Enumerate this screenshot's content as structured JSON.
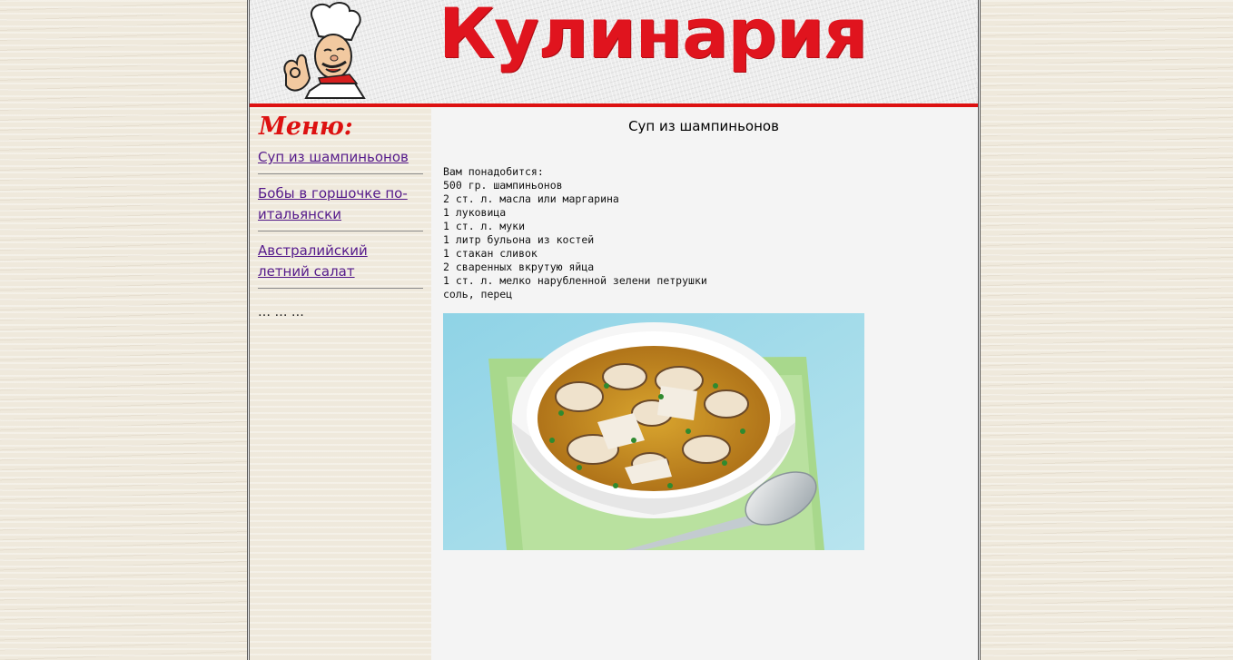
{
  "header": {
    "site_title": "Кулинария",
    "logo_icon": "chef-cartoon-icon",
    "accent_color": "#dd1111"
  },
  "sidebar": {
    "menu_title": "Меню:",
    "items": [
      {
        "label": "Суп из шампиньонов"
      },
      {
        "label": "Бобы в горшочке по-итальянски"
      },
      {
        "label": "Австралийский летний салат"
      }
    ],
    "more": "… … …"
  },
  "main": {
    "recipe_title": "Суп из шампиньонов",
    "ingredients_heading": "Вам понадобится:",
    "ingredients": [
      "500 гр. шампиньонов",
      "2 ст. л. масла или маргарина",
      "1 луковица",
      "1 ст. л. муки",
      "1 литр бульона из костей",
      "1 стакан сливок",
      "2 сваренных вкрутую яйца",
      "1 ст. л. мелко нарубленной зелени петрушки",
      "соль, перец"
    ],
    "photo_icon": "mushroom-soup-photo"
  }
}
